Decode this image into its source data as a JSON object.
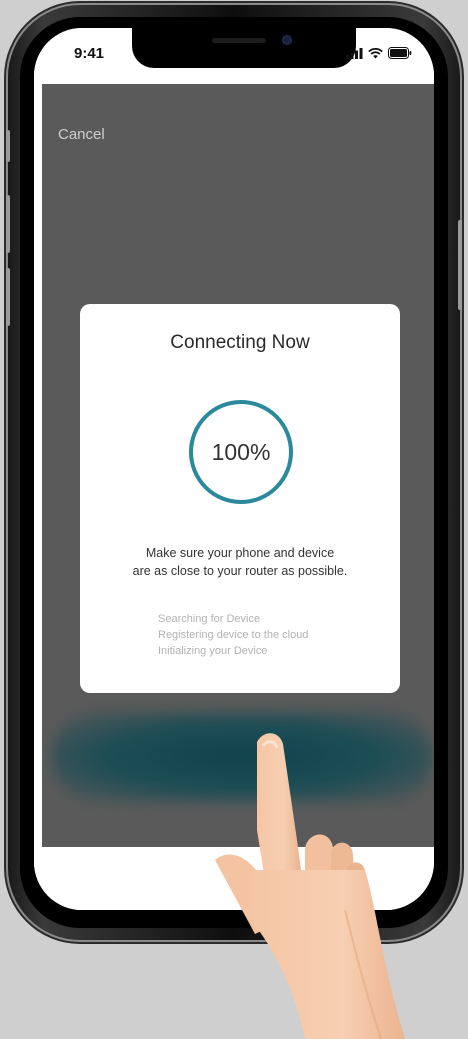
{
  "status_bar": {
    "time": "9:41"
  },
  "app": {
    "cancel_label": "Cancel"
  },
  "modal": {
    "title": "Connecting Now",
    "progress_percent": 100,
    "progress_label": "100%",
    "hint_line1": "Make sure your phone and device",
    "hint_line2": "are as close to your router as possible.",
    "steps": [
      "Searching for Device",
      "Registering device to the cloud",
      "Initializing your Device"
    ]
  },
  "icons": {
    "signal": "signal-icon",
    "wifi": "wifi-icon",
    "battery": "battery-icon",
    "hand": "pointing-hand-icon"
  },
  "colors": {
    "progress_ring": "#2a8a9c",
    "overlay": "#5a5a5a",
    "step_text": "#b3b3b3"
  }
}
